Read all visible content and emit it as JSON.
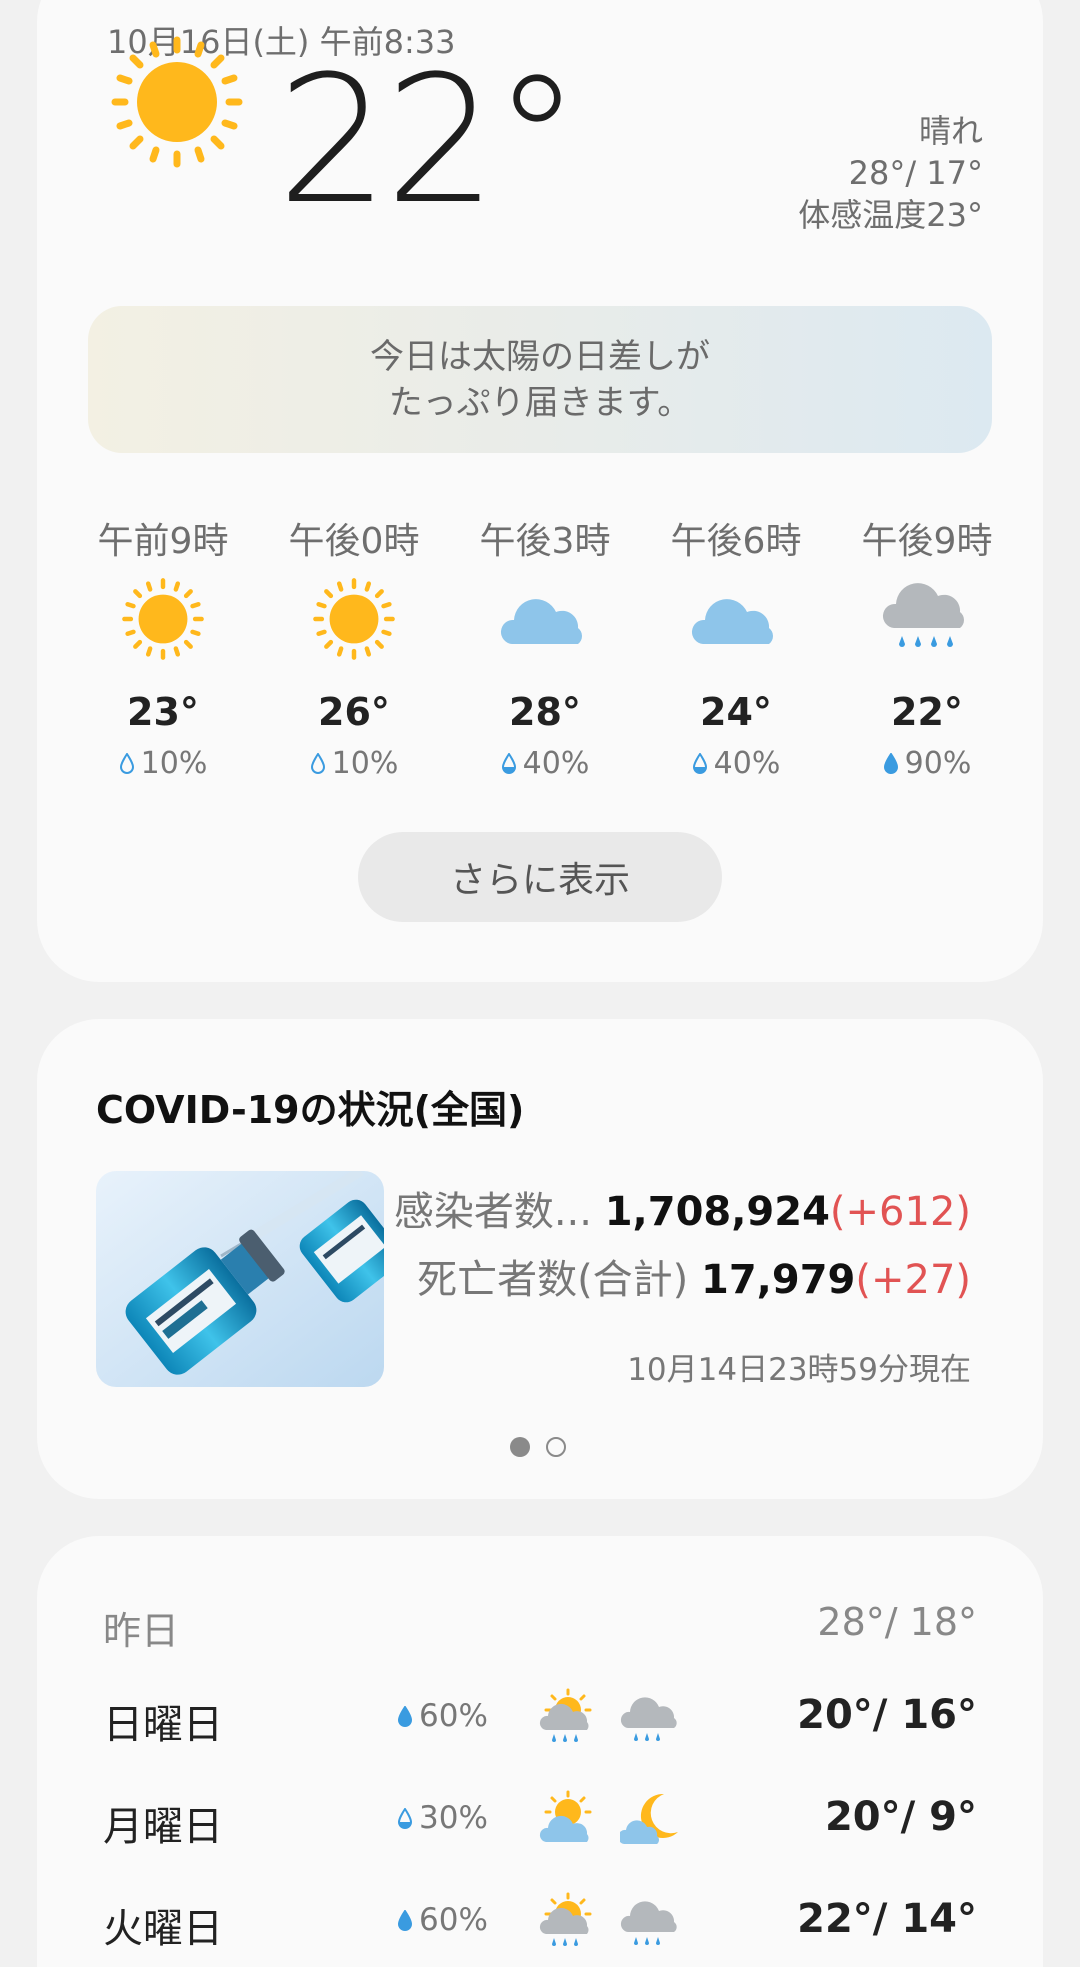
{
  "current": {
    "datetime": "10月16日(土) 午前8:33",
    "temp": "22°",
    "condition": "晴れ",
    "high_low": "28°/ 17°",
    "feels_like": "体感温度23°",
    "summary_line1": "今日は太陽の日差しが",
    "summary_line2": "たっぷり届きます。",
    "icon": "sun-icon"
  },
  "hourly": [
    {
      "time": "午前9時",
      "icon": "sun-icon",
      "temp": "23°",
      "pop": "10%"
    },
    {
      "time": "午後0時",
      "icon": "sun-icon",
      "temp": "26°",
      "pop": "10%"
    },
    {
      "time": "午後3時",
      "icon": "cloud-icon",
      "temp": "28°",
      "pop": "40%"
    },
    {
      "time": "午後6時",
      "icon": "cloud-icon",
      "temp": "24°",
      "pop": "40%"
    },
    {
      "time": "午後9時",
      "icon": "rain-cloud-icon",
      "temp": "22°",
      "pop": "90%"
    }
  ],
  "more_button": "さらに表示",
  "covid": {
    "title": "COVID-19の状況(全国)",
    "infected_label": "感染者数...",
    "infected_value": "1,708,924",
    "infected_delta": "(+612)",
    "deaths_label": "死亡者数(合計)",
    "deaths_value": "17,979",
    "deaths_delta": "(+27)",
    "as_of": "10月14日23時59分現在",
    "image_alt": "vaccine-image",
    "page_index": 1,
    "page_count": 2
  },
  "daily": {
    "yesterday_label": "昨日",
    "yesterday_temp": "28°/ 18°",
    "days": [
      {
        "name": "日曜日",
        "pop": "60%",
        "icon_am": "sun-rain-icon",
        "icon_pm": "rain-cloud-icon",
        "temp": "20°/ 16°"
      },
      {
        "name": "月曜日",
        "pop": "30%",
        "icon_am": "sun-cloud-icon",
        "icon_pm": "moon-cloud-icon",
        "temp": "20°/ 9°"
      },
      {
        "name": "火曜日",
        "pop": "60%",
        "icon_am": "sun-rain-icon",
        "icon_pm": "rain-cloud-icon",
        "temp": "22°/ 14°"
      }
    ]
  },
  "colors": {
    "sun": "#FFB81C",
    "cloud": "#8EC5EA",
    "rain_cloud": "#B4B8BC",
    "rain": "#3A9BE0",
    "delta": "#E15353"
  }
}
